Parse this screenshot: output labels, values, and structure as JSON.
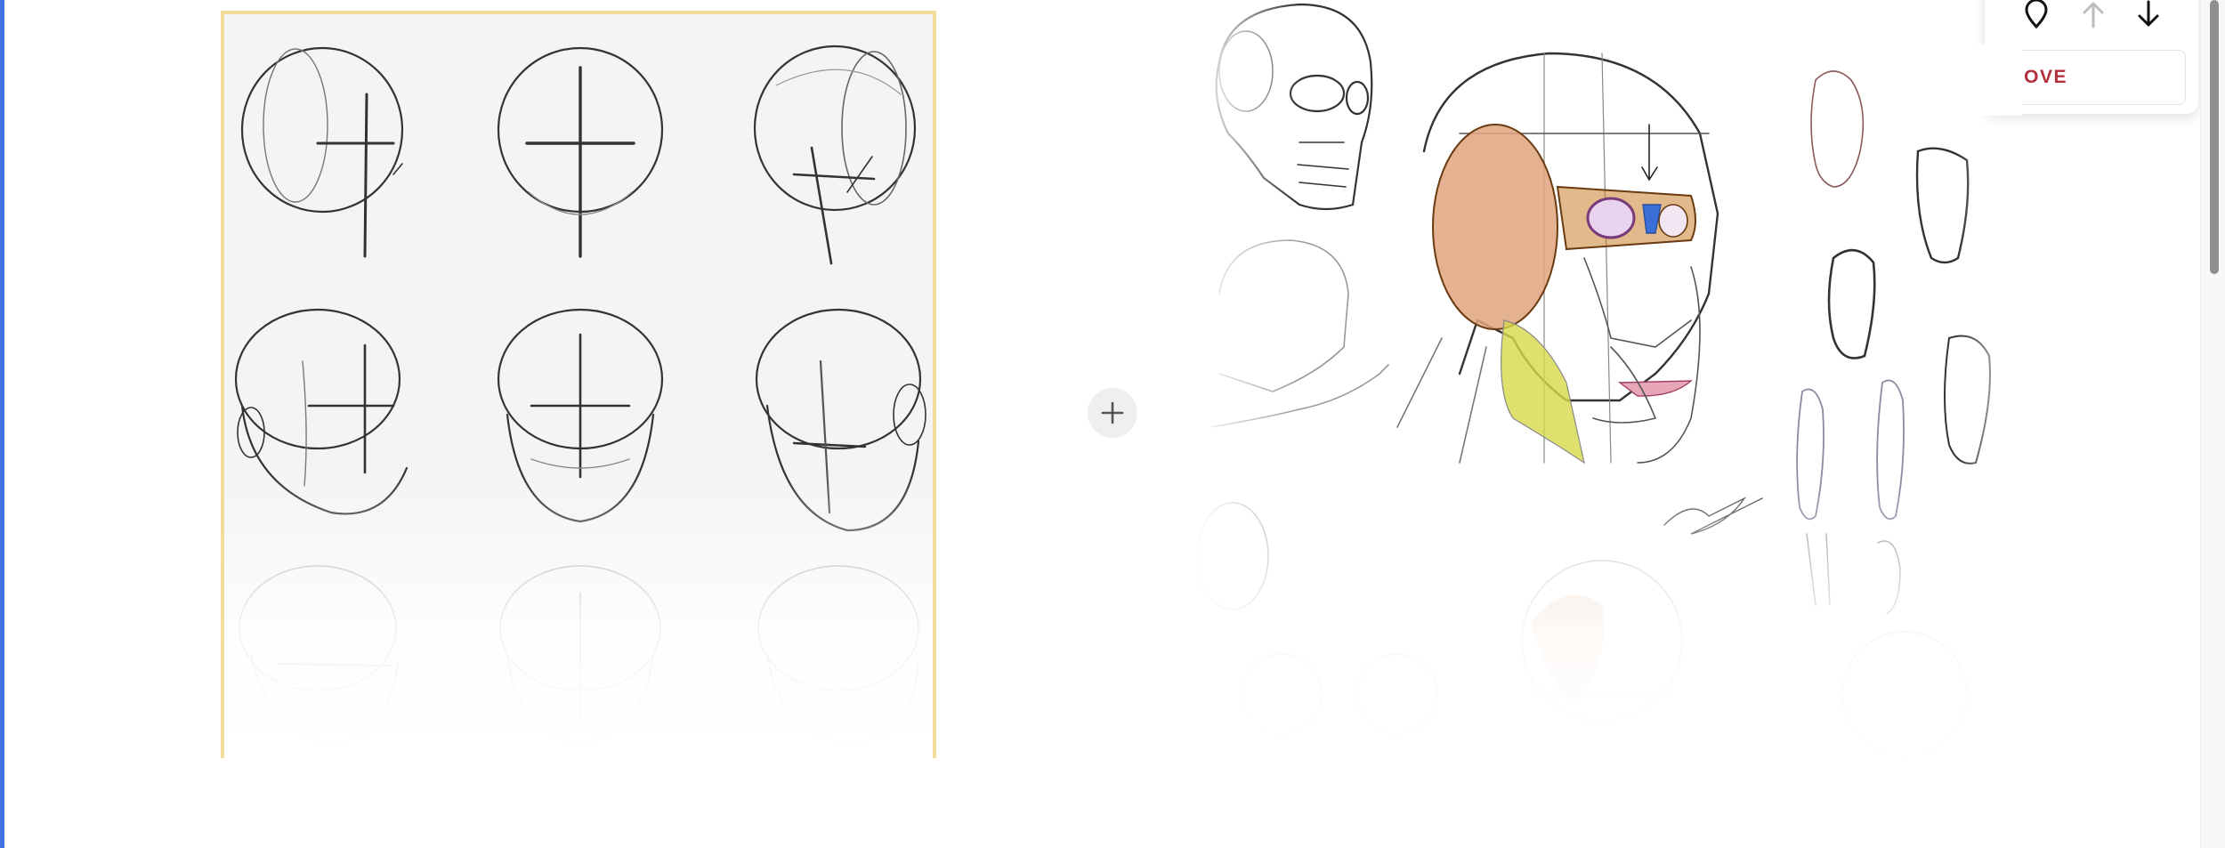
{
  "actions": {
    "remove_label": "REMOVE",
    "icons": [
      "pin-icon",
      "arrow-up-icon",
      "arrow-down-icon"
    ],
    "add_icon": "plus-icon"
  },
  "images": [
    {
      "name": "head-construction-sketches"
    },
    {
      "name": "head-anatomy-and-ear-studies"
    }
  ],
  "colors": {
    "accent_blue": "#3f73e0",
    "remove_text": "#b0303c",
    "left_card_border": "#f1dc9a",
    "skin_tone": "#e0a57e",
    "jaw_yellow": "#d8d84a"
  }
}
